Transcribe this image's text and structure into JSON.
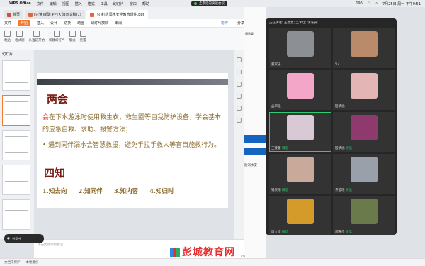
{
  "menubar": {
    "app": "WPS Office",
    "items": [
      "文件",
      "编辑",
      "视图",
      "插入",
      "格式",
      "工具",
      "幻灯片",
      "窗口",
      "帮助"
    ],
    "datetime": "7月25日 周一 下午9:51",
    "battery": "196"
  },
  "recording": {
    "label": "孟李廷的快速会议"
  },
  "tabs": [
    {
      "label": "首页",
      "color": "#d84e3a"
    },
    {
      "label": "[只读]新建 PPTX 演示文稿(1)",
      "color": "#e8623a"
    },
    {
      "label": "[只读]防溺水安全教育课件.ppt",
      "color": "#e8623a"
    }
  ],
  "ribbon": {
    "items": [
      "文件",
      "开始",
      "插入",
      "设计",
      "切换",
      "动画",
      "幻灯片放映",
      "审阅"
    ],
    "collab": "协作",
    "share": "分享"
  },
  "toolbar": {
    "tools": [
      "粘贴",
      "格式刷",
      "从当前开始",
      "新建幻灯片",
      "版式",
      "重置"
    ]
  },
  "panel": {
    "label": "幻灯片"
  },
  "slide": {
    "title": "两会",
    "line1_hl": "会",
    "line1": "在下水游泳时使用救生衣、救生圈等自我防护设备，学会基本的应急自救、求助、报警方法；",
    "bullet": "• 遇到同伴溺水会智慧救援，避免手拉手救人等盲目施救行为。",
    "title2": "四知",
    "knows": [
      "1.知去向",
      "2.知同伴",
      "3.知内容",
      "4.知归时"
    ]
  },
  "notes": {
    "placeholder": "单击此处添加备注"
  },
  "statusbar": {
    "doc_protect": "文档未保护",
    "local_backup": "本地备份"
  },
  "rec_pill": {
    "label": "共享中"
  },
  "middle": {
    "label": "通讯录",
    "text": "防溺水安"
  },
  "meeting": {
    "speaking": "正在讲话: 王萱萱; 孟李廷; 李浩辰;",
    "participants": [
      {
        "name": "董家乐",
        "wechat": "",
        "photo": "#8c8f93"
      },
      {
        "name": "Yu.",
        "wechat": "",
        "photo": "#b98b6b"
      },
      {
        "name": "孟李廷",
        "wechat": "",
        "photo": "#f3a6c8"
      },
      {
        "name": "殷梦涵",
        "wechat": "",
        "photo": "#e3b5b5"
      },
      {
        "name": "王萱萱",
        "wechat": "微信",
        "photo": "#d8c9d4"
      },
      {
        "name": "殷梦涵",
        "wechat": "微信",
        "photo": "#8e3a6e"
      },
      {
        "name": "钱天翔",
        "wechat": "微信",
        "photo": "#c9a99a"
      },
      {
        "name": "许蓝瑶",
        "wechat": "微信",
        "photo": "#9aa0aa"
      },
      {
        "name": "周文博",
        "wechat": "微信",
        "photo": "#d49a2a"
      },
      {
        "name": "郝嘉佳",
        "wechat": "微信",
        "photo": "#6a7a4a"
      }
    ]
  },
  "watermark": {
    "text": "彭城教育网",
    "domain": "cn"
  }
}
